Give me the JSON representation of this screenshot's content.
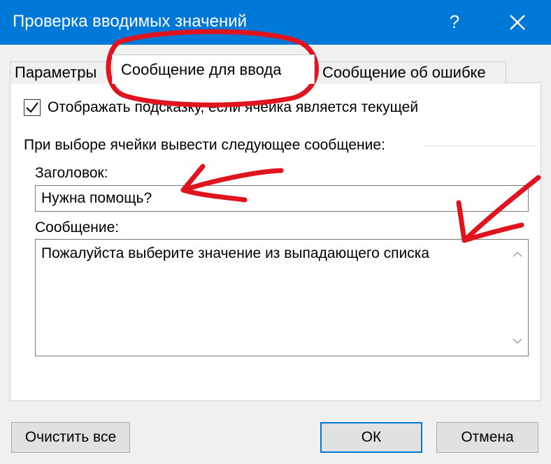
{
  "window": {
    "title": "Проверка вводимых значений",
    "help_glyph": "?",
    "accent_color": "#0078d7"
  },
  "tabs": [
    {
      "label": "Параметры",
      "active": false
    },
    {
      "label": "Сообщение для ввода",
      "active": true
    },
    {
      "label": "Сообщение об ошибке",
      "active": false
    }
  ],
  "input_message": {
    "show_checkbox_label": "Отображать подсказку, если ячейка является текущей",
    "show_checked": true,
    "group_label": "При выборе ячейки вывести следующее сообщение:",
    "title_label": "Заголовок:",
    "title_value": "Нужна помощь?",
    "message_label": "Сообщение:",
    "message_value": "Пожалуйста выберите значение из выпадающего списка"
  },
  "buttons": {
    "clear_all": "Очистить все",
    "ok": "ОК",
    "cancel": "Отмена"
  },
  "annotations": {
    "color": "#e0141e",
    "items": [
      "circle-around-active-tab",
      "arrow-to-title-field",
      "arrow-to-message-field"
    ]
  }
}
